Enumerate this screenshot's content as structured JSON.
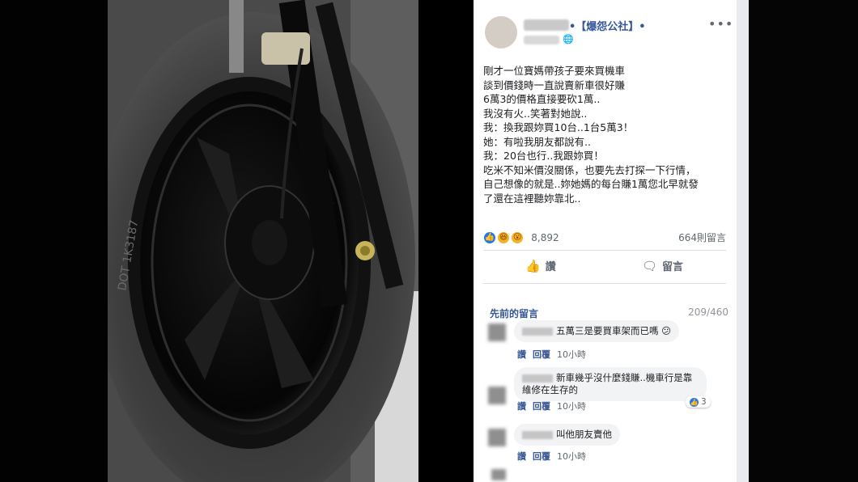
{
  "post": {
    "page_name": "•【爆怨公社】•",
    "more_glyph": "•••",
    "globe_glyph": "🌐",
    "body_lines": [
      "剛才一位寶媽帶孩子要來買機車",
      "談到價錢時一直說賣新車很好賺",
      "6萬3的價格直接要砍1萬..",
      "我沒有火..笑著對她說..",
      "我：換我跟妳買10台..1台5萬3！",
      "她：有啦我朋友都說有..",
      "我：20台也行..我跟妳買！",
      "吃米不知米價沒關係，也要先去打探一下行情，",
      "自己想像的就是..妳她媽的每台賺1萬您北早就發",
      "了還在這裡聽妳靠北.."
    ],
    "reaction_count": "8,892",
    "comment_count": "664則留言",
    "like_label": "讚",
    "comment_label": "留言"
  },
  "comments_section": {
    "previous_label": "先前的留言",
    "total": "209/460",
    "comments": [
      {
        "text": "五萬三是要買車架而已嗎 😕",
        "like": "讚",
        "reply": "回覆",
        "time": "10小時"
      },
      {
        "text_line1": "新車幾乎沒什麼錢賺..機車行是靠",
        "text_line2": "維修在生存的",
        "like": "讚",
        "reply": "回覆",
        "time": "10小時",
        "reactions": "3"
      },
      {
        "text": "叫他朋友賣他",
        "like": "讚",
        "reply": "回覆",
        "time": "10小時"
      }
    ]
  },
  "colors": {
    "link_blue": "#365899",
    "like_blue": "#2078f4",
    "bubble_gray": "#f2f3f5"
  }
}
